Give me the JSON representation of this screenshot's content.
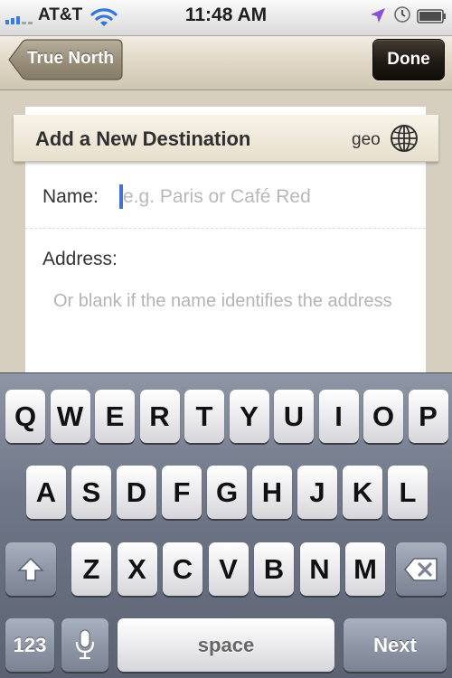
{
  "status_bar": {
    "carrier": "AT&T",
    "time": "11:48 AM"
  },
  "nav": {
    "back_label": "True North",
    "done_label": "Done"
  },
  "form": {
    "title": "Add a New Destination",
    "geo_label": "geo",
    "name_label": "Name:",
    "name_placeholder": "e.g. Paris or Café Red",
    "name_value": "",
    "address_label": "Address:",
    "address_placeholder": "Or blank if the name identifies the address",
    "address_value": ""
  },
  "keyboard": {
    "row1": [
      "Q",
      "W",
      "E",
      "R",
      "T",
      "Y",
      "U",
      "I",
      "O",
      "P"
    ],
    "row2": [
      "A",
      "S",
      "D",
      "F",
      "G",
      "H",
      "J",
      "K",
      "L"
    ],
    "row3": [
      "Z",
      "X",
      "C",
      "V",
      "B",
      "N",
      "M"
    ],
    "numbers_label": "123",
    "space_label": "space",
    "return_label": "Next"
  },
  "icons": {
    "wifi": "wifi-icon",
    "location": "location-arrow-icon",
    "clock": "clock-icon",
    "battery": "battery-icon",
    "globe": "globe-icon",
    "shift": "shift-icon",
    "delete": "delete-icon",
    "mic": "microphone-icon"
  },
  "colors": {
    "location_arrow": "#8a4fd6",
    "cursor": "#4670d8"
  }
}
